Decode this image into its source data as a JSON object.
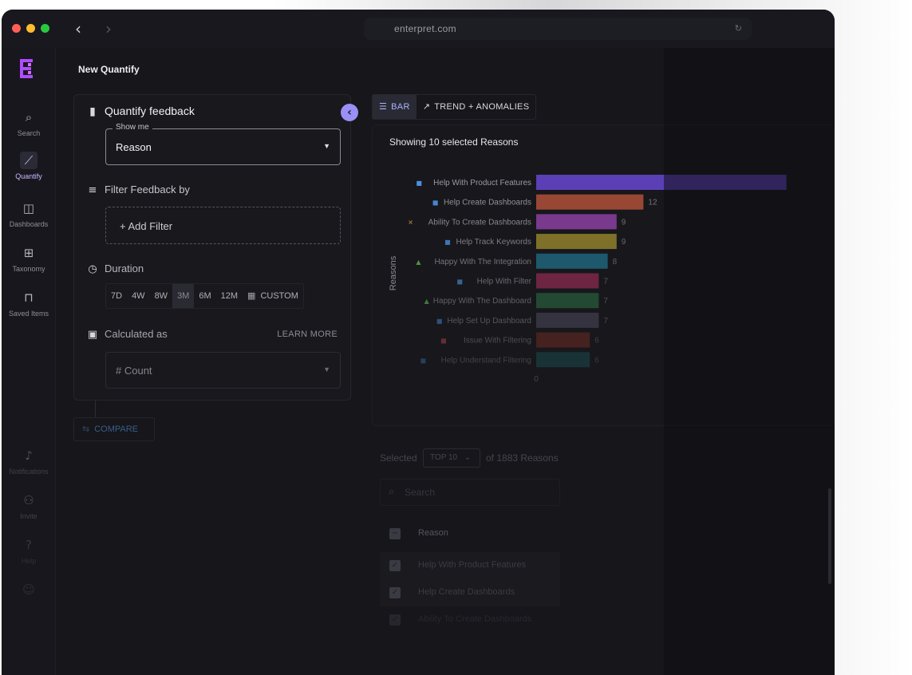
{
  "browser": {
    "url": "enterpret.com"
  },
  "sidebar": {
    "items": [
      {
        "label": "Search",
        "icon": "search-list-icon"
      },
      {
        "label": "Quantify",
        "icon": "trend-chart-icon"
      },
      {
        "label": "Dashboards",
        "icon": "dashboard-icon"
      },
      {
        "label": "Taxonomy",
        "icon": "taxonomy-icon"
      },
      {
        "label": "Saved Items",
        "icon": "bookmark-icon"
      },
      {
        "label": "Notifications",
        "icon": "bell-icon"
      },
      {
        "label": "Invite",
        "icon": "add-user-icon"
      },
      {
        "label": "Help",
        "icon": "help-icon"
      },
      {
        "label": "",
        "icon": "profile-icon"
      }
    ],
    "active": "Quantify"
  },
  "page": {
    "title": "New Quantify"
  },
  "quantify": {
    "heading": "Quantify feedback",
    "show_me_label": "Show me",
    "show_me_value": "Reason",
    "filter_heading": "Filter Feedback by",
    "add_filter": "+ Add Filter",
    "duration_heading": "Duration",
    "durations": [
      "7D",
      "4W",
      "8W",
      "3M",
      "6M",
      "12M",
      "CUSTOM"
    ],
    "selected_duration": "3M",
    "calculated_heading": "Calculated as",
    "learn_more": "LEARN MORE",
    "calculated_value": "# Count",
    "compare": "COMPARE"
  },
  "view_tabs": {
    "bar": "BAR",
    "trend": "TREND + ANOMALIES",
    "selected": "BAR"
  },
  "chart_data": {
    "type": "bar",
    "orientation": "horizontal",
    "title": "Showing 10 selected Reasons",
    "ylabel": "Reasons",
    "categories": [
      "Help With Product Features",
      "Help Create Dashboards",
      "Ability To Create Dashboards",
      "Help Track Keywords",
      "Happy With The Integration",
      "Help With Filter",
      "Happy With The Dashboard",
      "Help Set Up Dashboard",
      "Issue With Filtering",
      "Help Understand Filtering"
    ],
    "category_icons": [
      "chat",
      "chat",
      "tools",
      "chat",
      "thumbs-up",
      "chat",
      "thumbs-up",
      "chat",
      "flag",
      "chat"
    ],
    "values": [
      28,
      12,
      9,
      9,
      8,
      7,
      7,
      7,
      6,
      6
    ],
    "labels": [
      "",
      "12",
      "9",
      "9",
      "8",
      "7",
      "7",
      "7",
      "6",
      "6"
    ],
    "colors": [
      "#5b3fb5",
      "#a24b36",
      "#8b3fa0",
      "#9c8a2e",
      "#22748f",
      "#a12e5a",
      "#2e7346",
      "#565268",
      "#8a3324",
      "#1f6a6b"
    ],
    "x_tick_labels": [
      "0"
    ],
    "grid": false,
    "legend": "none"
  },
  "table": {
    "selected_label": "Selected",
    "top_value": "TOP 10",
    "of_label": "of 1883 Reasons",
    "search_placeholder": "Search",
    "column": "Reason",
    "rows": [
      "Help With Product Features",
      "Help Create Dashboards",
      "Ability To Create Dashboards"
    ]
  }
}
